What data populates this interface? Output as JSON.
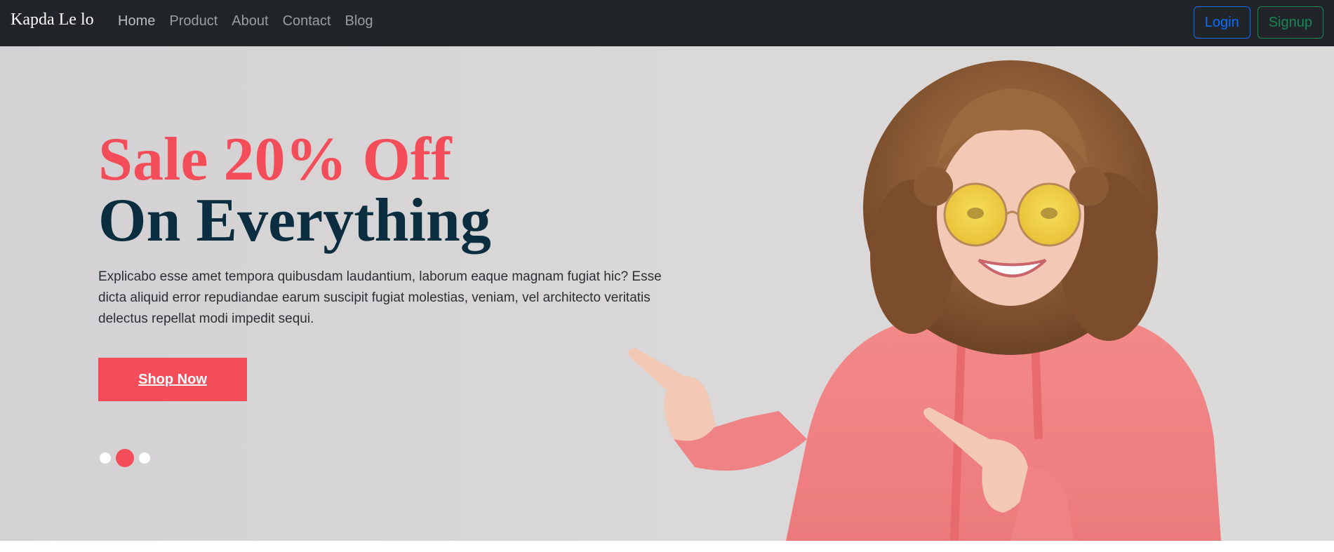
{
  "navbar": {
    "brand": "Kapda Le lo",
    "links": [
      "Home",
      "Product",
      "About",
      "Contact",
      "Blog"
    ],
    "login_label": "Login",
    "signup_label": "Signup"
  },
  "hero": {
    "title_line_1": "Sale 20% Off",
    "title_line_2": "On Everything",
    "description": "Explicabo esse amet tempora quibusdam laudantium, laborum eaque magnam fugiat hic? Esse dicta aliquid error repudiandae earum suscipit fugiat molestias, veniam, vel architecto veritatis delectus repellat modi impedit sequi.",
    "cta_label": "Shop Now",
    "carousel": {
      "slide_count": 3,
      "active_index": 1
    }
  },
  "colors": {
    "navbar_bg": "#212529",
    "accent": "#f44d5a",
    "heading_dark": "#0a2e3f",
    "login_blue": "#0d6efd",
    "signup_green": "#198754"
  }
}
